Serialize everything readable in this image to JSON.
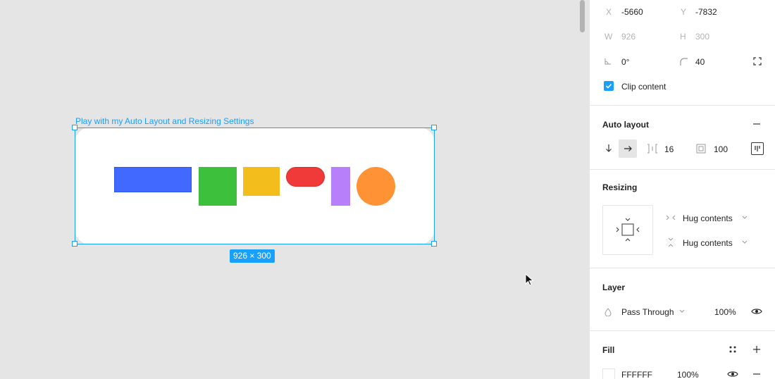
{
  "canvas": {
    "frame_label": "Play with my Auto Layout and Resizing Settings",
    "size_badge": "926 × 300",
    "frame_fill": "#FFFFFF",
    "selection_color": "#18A0FB",
    "shape_colors": {
      "blue": "#4169FF",
      "green": "#3DC13C",
      "yellow": "#F3BE1B",
      "red": "#F03A3A",
      "purple": "#B77FF9",
      "orange": "#FF9234"
    }
  },
  "transform": {
    "x_label": "X",
    "x_value": "-5660",
    "y_label": "Y",
    "y_value": "-7832",
    "w_label": "W",
    "w_value": "926",
    "h_label": "H",
    "h_value": "300",
    "rotation_value": "0°",
    "radius_value": "40",
    "clip_content_label": "Clip content",
    "clip_content_checked": true,
    "icons": [
      "rotation-icon",
      "corner-radius-icon",
      "independent-corners-icon",
      "check-icon"
    ]
  },
  "auto_layout": {
    "title": "Auto layout",
    "spacing_value": "16",
    "padding_value": "100",
    "direction_selected": "horizontal",
    "icons": [
      "remove-icon",
      "arrow-down-icon",
      "arrow-right-icon",
      "spacing-icon",
      "padding-icon",
      "alignment-icon"
    ]
  },
  "resizing": {
    "title": "Resizing",
    "horizontal_option": "Hug contents",
    "vertical_option": "Hug contents",
    "icons": [
      "hug-horizontal-icon",
      "hug-vertical-icon",
      "chevron-down-icon"
    ]
  },
  "layer": {
    "title": "Layer",
    "blend_mode": "Pass Through",
    "opacity": "100%",
    "icons": [
      "blend-mode-icon",
      "chevron-down-icon",
      "eye-icon"
    ]
  },
  "fill": {
    "title": "Fill",
    "hex": "FFFFFF",
    "opacity": "100%",
    "icons": [
      "styles-icon",
      "plus-icon",
      "eye-icon",
      "minus-icon"
    ]
  }
}
